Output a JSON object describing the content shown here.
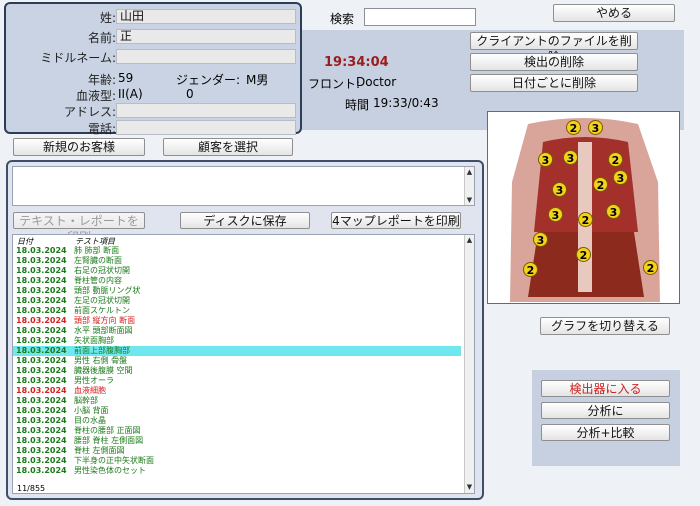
{
  "client": {
    "surname_label": "姓:",
    "surname": "山田",
    "name_label": "名前:",
    "name": "正",
    "middle_label": "ミドルネーム:",
    "middle": "",
    "age_label": "年齢:",
    "age": "59",
    "gender_label": "ジェンダー:",
    "gender": "M男",
    "blood_label": "血液型:",
    "blood": "II(A)",
    "rh": "0",
    "address_label": "アドレス:",
    "address": "",
    "phone_label": "電話:",
    "phone": ""
  },
  "search": {
    "label": "検索",
    "value": ""
  },
  "status": {
    "time": "19:34:04",
    "front_label": "フロント:",
    "front_value": "Doctor",
    "session_label": "時間",
    "session_value": "19:33/0:43"
  },
  "buttons": {
    "quit": "やめる",
    "delete_client": "クライアントのファイルを削除",
    "delete_detector": "検出の削除",
    "delete_by_date": "日付ごとに削除",
    "new_client": "新規のお客様",
    "select_client": "顧客を選択",
    "print_text": "テキスト・レポートを印刷",
    "save_disk": "ディスクに保存",
    "print_4map": "4マップレポートを印刷",
    "switch_graph": "グラフを切り替える",
    "enter_detector": "検出器に入る",
    "analyze": "分析に",
    "analyze_compare": "分析+比較"
  },
  "list": {
    "header_date": "日付",
    "header_test": "テスト項目",
    "footer": "11/855",
    "rows": [
      {
        "date": "18.03.2024",
        "test": "肺 肺部 断面",
        "color": "#1a7a1a"
      },
      {
        "date": "18.03.2024",
        "test": "左腎臓の断面",
        "color": "#1a7a1a"
      },
      {
        "date": "18.03.2024",
        "test": "右足の冠状切開",
        "color": "#1a7a1a"
      },
      {
        "date": "18.03.2024",
        "test": "脊柱管の内容",
        "color": "#1a7a1a"
      },
      {
        "date": "18.03.2024",
        "test": "頭部 動脈リング状",
        "color": "#1a7a1a"
      },
      {
        "date": "18.03.2024",
        "test": "左足の冠状切開",
        "color": "#1a7a1a"
      },
      {
        "date": "18.03.2024",
        "test": "前面スケルトン",
        "color": "#1a7a1a"
      },
      {
        "date": "18.03.2024",
        "test": "頭部 縦方向 断面",
        "color": "#d42020"
      },
      {
        "date": "18.03.2024",
        "test": "水平 頭部断面図",
        "color": "#1a7a1a"
      },
      {
        "date": "18.03.2024",
        "test": "矢状面胸部",
        "color": "#1a7a1a"
      },
      {
        "date": "18.03.2024",
        "test": "前面上部腹胸部",
        "color": "#1a7a1a",
        "selected": true
      },
      {
        "date": "18.03.2024",
        "test": "男性 右側 骨盤",
        "color": "#1a7a1a"
      },
      {
        "date": "18.03.2024",
        "test": "臓器後腹膜 空間",
        "color": "#1a7a1a"
      },
      {
        "date": "18.03.2024",
        "test": "男性オーラ",
        "color": "#1a7a1a"
      },
      {
        "date": "18.03.2024",
        "test": "血液細胞",
        "color": "#d42020"
      },
      {
        "date": "18.03.2024",
        "test": "脳幹部",
        "color": "#1a7a1a"
      },
      {
        "date": "18.03.2024",
        "test": "小脳 背面",
        "color": "#1a7a1a"
      },
      {
        "date": "18.03.2024",
        "test": "目の水晶",
        "color": "#1a7a1a"
      },
      {
        "date": "18.03.2024",
        "test": "脊柱の腰部 正面図",
        "color": "#1a7a1a"
      },
      {
        "date": "18.03.2024",
        "test": "腰部 脊柱 左側面図",
        "color": "#1a7a1a"
      },
      {
        "date": "18.03.2024",
        "test": "脊柱 左側面図",
        "color": "#1a7a1a"
      },
      {
        "date": "18.03.2024",
        "test": "下半身の正中矢状断面",
        "color": "#1a7a1a"
      },
      {
        "date": "18.03.2024",
        "test": "男性染色体のセット",
        "color": "#1a7a1a"
      }
    ]
  },
  "colors": {
    "time": "#9a1c1c",
    "selection": "#6ee8ee",
    "badge": "#f2d21a"
  },
  "graph": {
    "badges": [
      "2",
      "3",
      "3",
      "3",
      "2",
      "3",
      "2",
      "3",
      "3",
      "2",
      "3",
      "3",
      "2",
      "2",
      "2"
    ]
  }
}
